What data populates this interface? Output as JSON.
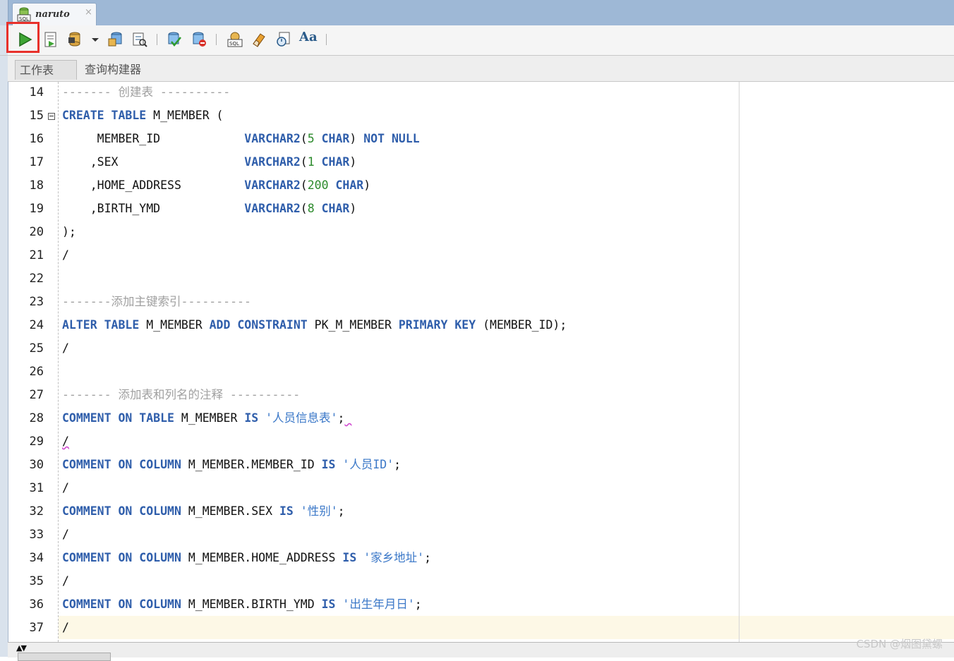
{
  "editor_tab": {
    "title": "naruto",
    "close_glyph": "×",
    "icon": "sql-connection-icon"
  },
  "toolbar": {
    "buttons": [
      {
        "name": "run-statement-button",
        "icon": "play-icon"
      },
      {
        "name": "run-script-button",
        "icon": "run-script-icon"
      },
      {
        "name": "commit-button",
        "icon": "commit-icon"
      },
      {
        "name": "dropdown-button",
        "icon": "chevron-down-icon"
      },
      {
        "name": "rollback-button",
        "icon": "rollback-icon"
      },
      {
        "name": "explain-plan-button",
        "icon": "explain-plan-icon"
      },
      {
        "name": "autotrace-button",
        "icon": "autotrace-icon"
      },
      {
        "name": "clear-button",
        "icon": "clear-icon"
      },
      {
        "name": "sql-history-button",
        "icon": "sql-history-icon"
      },
      {
        "name": "eraser-button",
        "icon": "eraser-icon"
      },
      {
        "name": "sql-tuning-button",
        "icon": "sql-tuning-icon"
      },
      {
        "name": "format-case-button",
        "icon": "case-icon"
      }
    ],
    "case_label": "Aa"
  },
  "sub_tabs": {
    "worksheet": "工作表",
    "query_builder": "查询构建器"
  },
  "lines": [
    {
      "n": "14",
      "segs": [
        {
          "t": "------- 创建表 ----------",
          "c": "cmt"
        }
      ]
    },
    {
      "n": "15",
      "fold": true,
      "segs": [
        {
          "t": "CREATE",
          "c": "kw"
        },
        {
          "t": " "
        },
        {
          "t": "TABLE",
          "c": "kw"
        },
        {
          "t": " M_MEMBER ("
        }
      ]
    },
    {
      "n": "16",
      "segs": [
        {
          "t": "     MEMBER_ID            "
        },
        {
          "t": "VARCHAR2",
          "c": "kw"
        },
        {
          "t": "("
        },
        {
          "t": "5",
          "c": "num"
        },
        {
          "t": " "
        },
        {
          "t": "CHAR",
          "c": "kw"
        },
        {
          "t": ") "
        },
        {
          "t": "NOT",
          "c": "kw"
        },
        {
          "t": " "
        },
        {
          "t": "NULL",
          "c": "kw"
        }
      ]
    },
    {
      "n": "17",
      "segs": [
        {
          "t": "    ,SEX                  "
        },
        {
          "t": "VARCHAR2",
          "c": "kw"
        },
        {
          "t": "("
        },
        {
          "t": "1",
          "c": "num"
        },
        {
          "t": " "
        },
        {
          "t": "CHAR",
          "c": "kw"
        },
        {
          "t": ")"
        }
      ]
    },
    {
      "n": "18",
      "segs": [
        {
          "t": "    ,HOME_ADDRESS         "
        },
        {
          "t": "VARCHAR2",
          "c": "kw"
        },
        {
          "t": "("
        },
        {
          "t": "200",
          "c": "num"
        },
        {
          "t": " "
        },
        {
          "t": "CHAR",
          "c": "kw"
        },
        {
          "t": ")"
        }
      ]
    },
    {
      "n": "19",
      "segs": [
        {
          "t": "    ,BIRTH_YMD            "
        },
        {
          "t": "VARCHAR2",
          "c": "kw"
        },
        {
          "t": "("
        },
        {
          "t": "8",
          "c": "num"
        },
        {
          "t": " "
        },
        {
          "t": "CHAR",
          "c": "kw"
        },
        {
          "t": ")"
        }
      ]
    },
    {
      "n": "20",
      "segs": [
        {
          "t": ");"
        }
      ]
    },
    {
      "n": "21",
      "segs": [
        {
          "t": "/"
        }
      ]
    },
    {
      "n": "22",
      "segs": []
    },
    {
      "n": "23",
      "segs": [
        {
          "t": "-------添加主键索引----------",
          "c": "cmt"
        }
      ]
    },
    {
      "n": "24",
      "segs": [
        {
          "t": "ALTER",
          "c": "kw"
        },
        {
          "t": " "
        },
        {
          "t": "TABLE",
          "c": "kw"
        },
        {
          "t": " M_MEMBER "
        },
        {
          "t": "ADD",
          "c": "kw"
        },
        {
          "t": " "
        },
        {
          "t": "CONSTRAINT",
          "c": "kw"
        },
        {
          "t": " PK_M_MEMBER "
        },
        {
          "t": "PRIMARY",
          "c": "kw"
        },
        {
          "t": " "
        },
        {
          "t": "KEY",
          "c": "kw"
        },
        {
          "t": " (MEMBER_ID);"
        }
      ]
    },
    {
      "n": "25",
      "segs": [
        {
          "t": "/"
        }
      ]
    },
    {
      "n": "26",
      "segs": []
    },
    {
      "n": "27",
      "segs": [
        {
          "t": "------- 添加表和列名的注释 ----------",
          "c": "cmt"
        }
      ]
    },
    {
      "n": "28",
      "segs": [
        {
          "t": "COMMENT",
          "c": "kw"
        },
        {
          "t": " "
        },
        {
          "t": "ON",
          "c": "kw"
        },
        {
          "t": " "
        },
        {
          "t": "TABLE",
          "c": "kw"
        },
        {
          "t": " M_MEMBER "
        },
        {
          "t": "IS",
          "c": "kw"
        },
        {
          "t": " "
        },
        {
          "t": "'人员信息表'",
          "c": "str"
        },
        {
          "t": ";"
        },
        {
          "t": " ",
          "c": "squig"
        }
      ]
    },
    {
      "n": "29",
      "segs": [
        {
          "t": "/",
          "c": "squig"
        }
      ]
    },
    {
      "n": "30",
      "segs": [
        {
          "t": "COMMENT",
          "c": "kw"
        },
        {
          "t": " "
        },
        {
          "t": "ON",
          "c": "kw"
        },
        {
          "t": " "
        },
        {
          "t": "COLUMN",
          "c": "kw"
        },
        {
          "t": " M_MEMBER.MEMBER_ID "
        },
        {
          "t": "IS",
          "c": "kw"
        },
        {
          "t": " "
        },
        {
          "t": "'人员ID'",
          "c": "str"
        },
        {
          "t": ";"
        }
      ]
    },
    {
      "n": "31",
      "segs": [
        {
          "t": "/"
        }
      ]
    },
    {
      "n": "32",
      "segs": [
        {
          "t": "COMMENT",
          "c": "kw"
        },
        {
          "t": " "
        },
        {
          "t": "ON",
          "c": "kw"
        },
        {
          "t": " "
        },
        {
          "t": "COLUMN",
          "c": "kw"
        },
        {
          "t": " M_MEMBER.SEX "
        },
        {
          "t": "IS",
          "c": "kw"
        },
        {
          "t": " "
        },
        {
          "t": "'性别'",
          "c": "str"
        },
        {
          "t": ";"
        }
      ]
    },
    {
      "n": "33",
      "segs": [
        {
          "t": "/"
        }
      ]
    },
    {
      "n": "34",
      "segs": [
        {
          "t": "COMMENT",
          "c": "kw"
        },
        {
          "t": " "
        },
        {
          "t": "ON",
          "c": "kw"
        },
        {
          "t": " "
        },
        {
          "t": "COLUMN",
          "c": "kw"
        },
        {
          "t": " M_MEMBER.HOME_ADDRESS "
        },
        {
          "t": "IS",
          "c": "kw"
        },
        {
          "t": " "
        },
        {
          "t": "'家乡地址'",
          "c": "str"
        },
        {
          "t": ";"
        }
      ]
    },
    {
      "n": "35",
      "segs": [
        {
          "t": "/"
        }
      ]
    },
    {
      "n": "36",
      "segs": [
        {
          "t": "COMMENT",
          "c": "kw"
        },
        {
          "t": " "
        },
        {
          "t": "ON",
          "c": "kw"
        },
        {
          "t": " "
        },
        {
          "t": "COLUMN",
          "c": "kw"
        },
        {
          "t": " M_MEMBER.BIRTH_YMD "
        },
        {
          "t": "IS",
          "c": "kw"
        },
        {
          "t": " "
        },
        {
          "t": "'出生年月日'",
          "c": "str"
        },
        {
          "t": ";"
        }
      ]
    },
    {
      "n": "37",
      "segs": [
        {
          "t": "/"
        }
      ]
    }
  ],
  "scroll_arrows": "▲▼",
  "watermark": "CSDN @烟图黛螺",
  "colors": {
    "keyword": "#2f5eab",
    "number": "#2b8a2b",
    "string": "#3b78c8",
    "comment": "#a0a0a0",
    "highlight_box": "#e8312b",
    "current_line": "#fdf8e6"
  }
}
